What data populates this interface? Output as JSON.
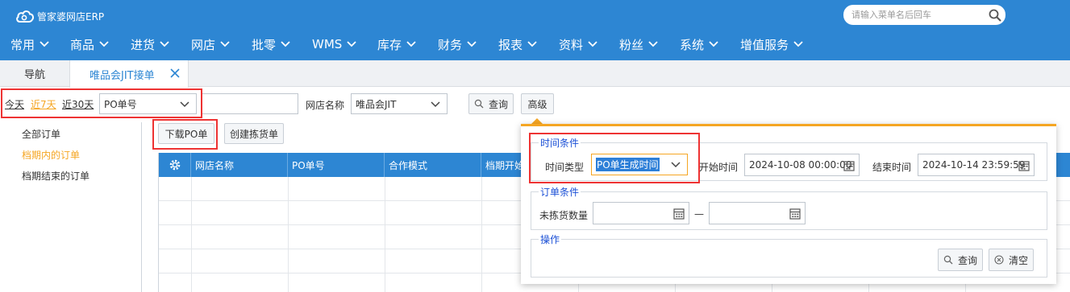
{
  "app": {
    "title": "管家婆网店ERP"
  },
  "search": {
    "placeholder": "请输入菜单名后回车"
  },
  "menu": [
    "常用",
    "商品",
    "进货",
    "网店",
    "批零",
    "WMS",
    "库存",
    "财务",
    "报表",
    "资料",
    "粉丝",
    "系统",
    "增值服务"
  ],
  "tabs": {
    "nav": "导航",
    "active": "唯品会JIT接单"
  },
  "filter": {
    "today": "今天",
    "last7": "近7天",
    "last30": "近30天",
    "field_select": "PO单号",
    "store_label": "网店名称",
    "store_value": "唯品会JIT",
    "query": "查询",
    "advanced": "高级"
  },
  "actions": {
    "download_po": "下载PO单",
    "create_pick": "创建拣货单"
  },
  "left_list": [
    "全部订单",
    "档期内的订单",
    "档期结束的订单"
  ],
  "grid": {
    "columns": [
      "网店名称",
      "PO单号",
      "合作模式",
      "档期开始"
    ]
  },
  "advanced": {
    "time_legend": "时间条件",
    "time_type_label": "时间类型",
    "time_type_value": "PO单生成时间",
    "start_label": "开始时间",
    "start_value": "2024-10-08 00:00:00",
    "end_label": "结束时间",
    "end_value": "2024-10-14 23:59:59",
    "order_legend": "订单条件",
    "unpicked_label": "未拣货数量",
    "range_dash": "—",
    "op_legend": "操作",
    "query": "查询",
    "clear": "清空"
  },
  "colors": {
    "brand": "#2d86d3",
    "accent_orange": "#f5a623",
    "highlight_red": "#ee3333",
    "legend_blue": "#1a4fd6"
  },
  "icons": [
    "cloud-logo-icon",
    "search-icon",
    "chevron-down-icon",
    "close-icon",
    "gear-icon",
    "calendar-icon",
    "clear-icon"
  ]
}
